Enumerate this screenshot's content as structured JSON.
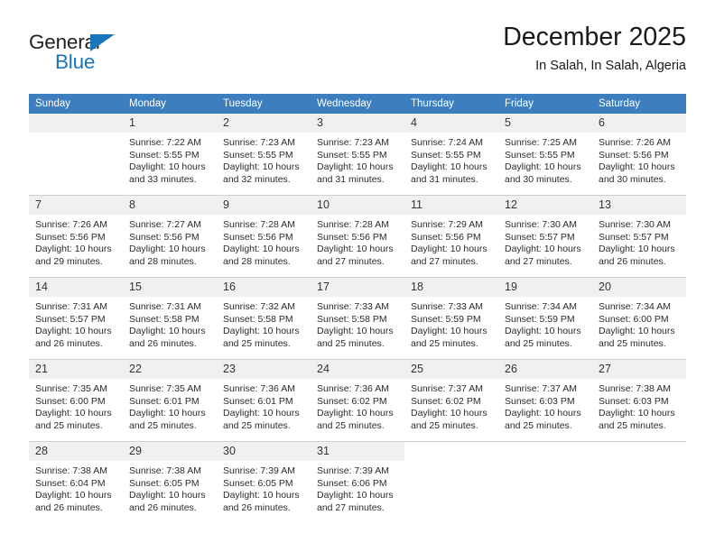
{
  "brand": {
    "name_part1": "General",
    "name_part2": "Blue",
    "triangle_icon": "triangle-icon",
    "accent_color": "#1b75bb",
    "text_color": "#231f20"
  },
  "header": {
    "title": "December 2025",
    "subtitle": "In Salah, In Salah, Algeria"
  },
  "calendar": {
    "header_bg": "#3d7ebe",
    "daynum_bg": "#f0f0f0",
    "weekdays": [
      "Sunday",
      "Monday",
      "Tuesday",
      "Wednesday",
      "Thursday",
      "Friday",
      "Saturday"
    ],
    "labels": {
      "sunrise": "Sunrise:",
      "sunset": "Sunset:",
      "daylight": "Daylight:"
    },
    "weeks": [
      [
        {
          "day": "",
          "sunrise": "",
          "sunset": "",
          "daylight_line1": "",
          "daylight_line2": "",
          "empty": true
        },
        {
          "day": "1",
          "sunrise": "Sunrise: 7:22 AM",
          "sunset": "Sunset: 5:55 PM",
          "daylight_line1": "Daylight: 10 hours",
          "daylight_line2": "and 33 minutes."
        },
        {
          "day": "2",
          "sunrise": "Sunrise: 7:23 AM",
          "sunset": "Sunset: 5:55 PM",
          "daylight_line1": "Daylight: 10 hours",
          "daylight_line2": "and 32 minutes."
        },
        {
          "day": "3",
          "sunrise": "Sunrise: 7:23 AM",
          "sunset": "Sunset: 5:55 PM",
          "daylight_line1": "Daylight: 10 hours",
          "daylight_line2": "and 31 minutes."
        },
        {
          "day": "4",
          "sunrise": "Sunrise: 7:24 AM",
          "sunset": "Sunset: 5:55 PM",
          "daylight_line1": "Daylight: 10 hours",
          "daylight_line2": "and 31 minutes."
        },
        {
          "day": "5",
          "sunrise": "Sunrise: 7:25 AM",
          "sunset": "Sunset: 5:55 PM",
          "daylight_line1": "Daylight: 10 hours",
          "daylight_line2": "and 30 minutes."
        },
        {
          "day": "6",
          "sunrise": "Sunrise: 7:26 AM",
          "sunset": "Sunset: 5:56 PM",
          "daylight_line1": "Daylight: 10 hours",
          "daylight_line2": "and 30 minutes."
        }
      ],
      [
        {
          "day": "7",
          "sunrise": "Sunrise: 7:26 AM",
          "sunset": "Sunset: 5:56 PM",
          "daylight_line1": "Daylight: 10 hours",
          "daylight_line2": "and 29 minutes."
        },
        {
          "day": "8",
          "sunrise": "Sunrise: 7:27 AM",
          "sunset": "Sunset: 5:56 PM",
          "daylight_line1": "Daylight: 10 hours",
          "daylight_line2": "and 28 minutes."
        },
        {
          "day": "9",
          "sunrise": "Sunrise: 7:28 AM",
          "sunset": "Sunset: 5:56 PM",
          "daylight_line1": "Daylight: 10 hours",
          "daylight_line2": "and 28 minutes."
        },
        {
          "day": "10",
          "sunrise": "Sunrise: 7:28 AM",
          "sunset": "Sunset: 5:56 PM",
          "daylight_line1": "Daylight: 10 hours",
          "daylight_line2": "and 27 minutes."
        },
        {
          "day": "11",
          "sunrise": "Sunrise: 7:29 AM",
          "sunset": "Sunset: 5:56 PM",
          "daylight_line1": "Daylight: 10 hours",
          "daylight_line2": "and 27 minutes."
        },
        {
          "day": "12",
          "sunrise": "Sunrise: 7:30 AM",
          "sunset": "Sunset: 5:57 PM",
          "daylight_line1": "Daylight: 10 hours",
          "daylight_line2": "and 27 minutes."
        },
        {
          "day": "13",
          "sunrise": "Sunrise: 7:30 AM",
          "sunset": "Sunset: 5:57 PM",
          "daylight_line1": "Daylight: 10 hours",
          "daylight_line2": "and 26 minutes."
        }
      ],
      [
        {
          "day": "14",
          "sunrise": "Sunrise: 7:31 AM",
          "sunset": "Sunset: 5:57 PM",
          "daylight_line1": "Daylight: 10 hours",
          "daylight_line2": "and 26 minutes."
        },
        {
          "day": "15",
          "sunrise": "Sunrise: 7:31 AM",
          "sunset": "Sunset: 5:58 PM",
          "daylight_line1": "Daylight: 10 hours",
          "daylight_line2": "and 26 minutes."
        },
        {
          "day": "16",
          "sunrise": "Sunrise: 7:32 AM",
          "sunset": "Sunset: 5:58 PM",
          "daylight_line1": "Daylight: 10 hours",
          "daylight_line2": "and 25 minutes."
        },
        {
          "day": "17",
          "sunrise": "Sunrise: 7:33 AM",
          "sunset": "Sunset: 5:58 PM",
          "daylight_line1": "Daylight: 10 hours",
          "daylight_line2": "and 25 minutes."
        },
        {
          "day": "18",
          "sunrise": "Sunrise: 7:33 AM",
          "sunset": "Sunset: 5:59 PM",
          "daylight_line1": "Daylight: 10 hours",
          "daylight_line2": "and 25 minutes."
        },
        {
          "day": "19",
          "sunrise": "Sunrise: 7:34 AM",
          "sunset": "Sunset: 5:59 PM",
          "daylight_line1": "Daylight: 10 hours",
          "daylight_line2": "and 25 minutes."
        },
        {
          "day": "20",
          "sunrise": "Sunrise: 7:34 AM",
          "sunset": "Sunset: 6:00 PM",
          "daylight_line1": "Daylight: 10 hours",
          "daylight_line2": "and 25 minutes."
        }
      ],
      [
        {
          "day": "21",
          "sunrise": "Sunrise: 7:35 AM",
          "sunset": "Sunset: 6:00 PM",
          "daylight_line1": "Daylight: 10 hours",
          "daylight_line2": "and 25 minutes."
        },
        {
          "day": "22",
          "sunrise": "Sunrise: 7:35 AM",
          "sunset": "Sunset: 6:01 PM",
          "daylight_line1": "Daylight: 10 hours",
          "daylight_line2": "and 25 minutes."
        },
        {
          "day": "23",
          "sunrise": "Sunrise: 7:36 AM",
          "sunset": "Sunset: 6:01 PM",
          "daylight_line1": "Daylight: 10 hours",
          "daylight_line2": "and 25 minutes."
        },
        {
          "day": "24",
          "sunrise": "Sunrise: 7:36 AM",
          "sunset": "Sunset: 6:02 PM",
          "daylight_line1": "Daylight: 10 hours",
          "daylight_line2": "and 25 minutes."
        },
        {
          "day": "25",
          "sunrise": "Sunrise: 7:37 AM",
          "sunset": "Sunset: 6:02 PM",
          "daylight_line1": "Daylight: 10 hours",
          "daylight_line2": "and 25 minutes."
        },
        {
          "day": "26",
          "sunrise": "Sunrise: 7:37 AM",
          "sunset": "Sunset: 6:03 PM",
          "daylight_line1": "Daylight: 10 hours",
          "daylight_line2": "and 25 minutes."
        },
        {
          "day": "27",
          "sunrise": "Sunrise: 7:38 AM",
          "sunset": "Sunset: 6:03 PM",
          "daylight_line1": "Daylight: 10 hours",
          "daylight_line2": "and 25 minutes."
        }
      ],
      [
        {
          "day": "28",
          "sunrise": "Sunrise: 7:38 AM",
          "sunset": "Sunset: 6:04 PM",
          "daylight_line1": "Daylight: 10 hours",
          "daylight_line2": "and 26 minutes."
        },
        {
          "day": "29",
          "sunrise": "Sunrise: 7:38 AM",
          "sunset": "Sunset: 6:05 PM",
          "daylight_line1": "Daylight: 10 hours",
          "daylight_line2": "and 26 minutes."
        },
        {
          "day": "30",
          "sunrise": "Sunrise: 7:39 AM",
          "sunset": "Sunset: 6:05 PM",
          "daylight_line1": "Daylight: 10 hours",
          "daylight_line2": "and 26 minutes."
        },
        {
          "day": "31",
          "sunrise": "Sunrise: 7:39 AM",
          "sunset": "Sunset: 6:06 PM",
          "daylight_line1": "Daylight: 10 hours",
          "daylight_line2": "and 27 minutes."
        },
        {
          "day": "",
          "sunrise": "",
          "sunset": "",
          "daylight_line1": "",
          "daylight_line2": "",
          "none": true
        },
        {
          "day": "",
          "sunrise": "",
          "sunset": "",
          "daylight_line1": "",
          "daylight_line2": "",
          "none": true
        },
        {
          "day": "",
          "sunrise": "",
          "sunset": "",
          "daylight_line1": "",
          "daylight_line2": "",
          "none": true
        }
      ]
    ]
  }
}
